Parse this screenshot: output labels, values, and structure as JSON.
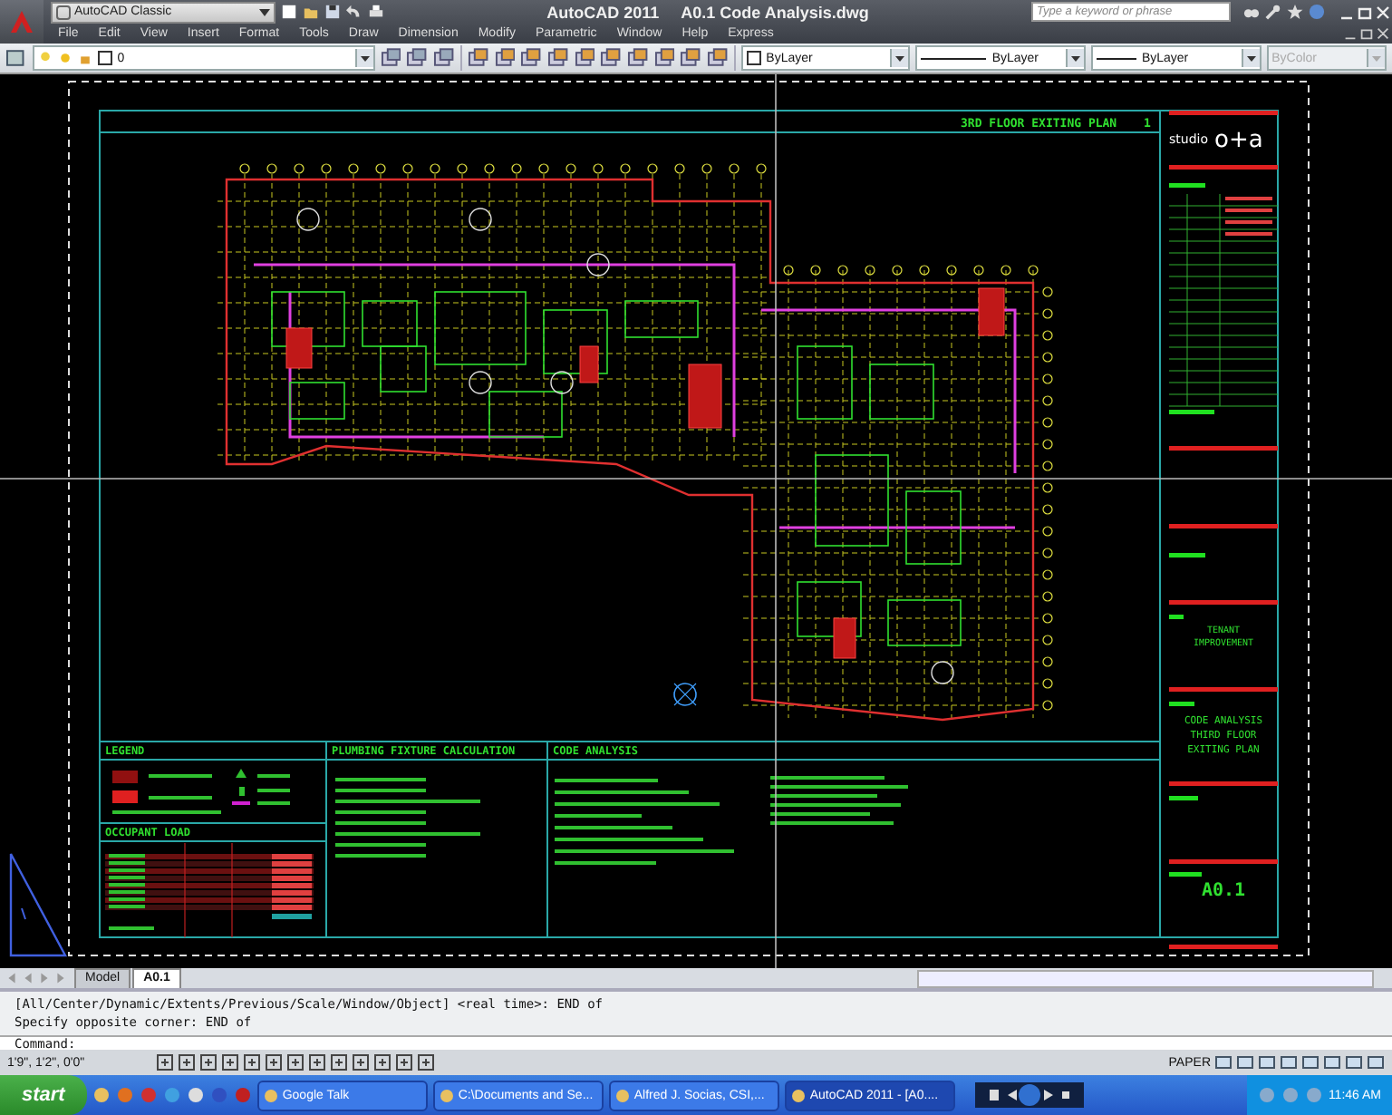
{
  "window": {
    "app_name": "AutoCAD 2011",
    "file_name": "A0.1 Code Analysis.dwg"
  },
  "workspace": "AutoCAD Classic",
  "search": {
    "placeholder": "Type a keyword or phrase"
  },
  "menu": [
    "File",
    "Edit",
    "View",
    "Insert",
    "Format",
    "Tools",
    "Draw",
    "Dimension",
    "Modify",
    "Parametric",
    "Window",
    "Help",
    "Express"
  ],
  "layer_toolbar": {
    "layer": "0",
    "color_control": "ByLayer",
    "linetype": "ByLayer",
    "lineweight": "ByLayer",
    "plot_style": {
      "value": "ByColor",
      "disabled": true
    }
  },
  "sheet": {
    "plan_title": "3RD FLOOR EXITING PLAN",
    "plan_number": "1",
    "panels": [
      {
        "title": "LEGEND"
      },
      {
        "title": "PLUMBING FIXTURE CALCULATION"
      },
      {
        "title": "CODE ANALYSIS"
      },
      {
        "title": "OCCUPANT LOAD"
      }
    ],
    "firm": "studio",
    "firm_mark": "o+a",
    "project": [
      "TENANT",
      "IMPROVEMENT"
    ],
    "drawing_title": [
      "CODE ANALYSIS",
      "THIRD FLOOR",
      "EXITING PLAN"
    ],
    "sheet_number": "A0.1"
  },
  "layout_tabs": [
    {
      "label": "Model",
      "selected": false
    },
    {
      "label": "A0.1",
      "selected": true
    }
  ],
  "command_history": [
    "[All/Center/Dynamic/Extents/Previous/Scale/Window/Object] <real time>: END of",
    "Specify opposite corner: END of"
  ],
  "command_prompt": "Command:",
  "status_bar": {
    "coordinates": "1'9\", 1'2\", 0'0\"",
    "space": "PAPER"
  },
  "taskbar": {
    "start": "start",
    "tasks": [
      {
        "label": "Google Talk",
        "selected": false
      },
      {
        "label": "C:\\Documents and Se...",
        "selected": false
      },
      {
        "label": "Alfred J. Socias, CSI,...",
        "selected": false
      },
      {
        "label": "AutoCAD 2011 - [A0....",
        "selected": true
      }
    ],
    "clock": "11:46 AM"
  }
}
